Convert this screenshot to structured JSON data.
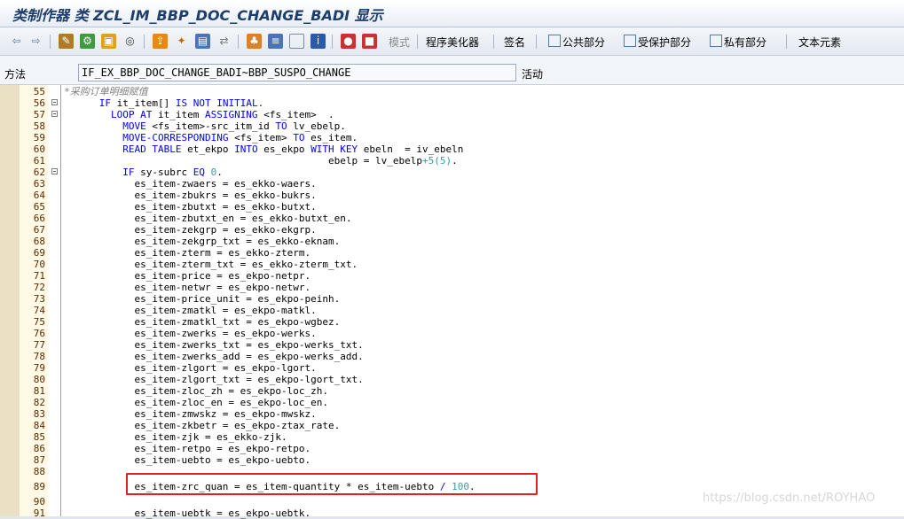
{
  "window": {
    "title": "类制作器 类 ZCL_IM_BBP_DOC_CHANGE_BADI 显示"
  },
  "toolbar": {
    "icons": [
      "back-arrow-icon",
      "forward-arrow-icon",
      "edit-toggle-icon",
      "other-object-icon",
      "activate-icon",
      "check-icon",
      "where-used-icon",
      "display-object-list-icon",
      "navigate-icon",
      "enhance-icon",
      "hierarchy-icon",
      "pretty-print-icon",
      "fullscreen-icon",
      "info-icon",
      "breakpoint-icon",
      "stop-icon"
    ],
    "mode_label": "模式",
    "pretty_printer_label": "程序美化器",
    "signature_label": "签名",
    "public_section_label": "公共部分",
    "protected_section_label": "受保护部分",
    "private_section_label": "私有部分",
    "text_elements_label": "文本元素"
  },
  "method_bar": {
    "label": "方法",
    "value": "IF_EX_BBP_DOC_CHANGE_BADI~BBP_SUSPO_CHANGE",
    "status": "活动"
  },
  "code_lines": [
    {
      "n": "55",
      "fold": false,
      "segs": [
        {
          "t": "*采购订单明细赋值",
          "c": "cm"
        }
      ]
    },
    {
      "n": "56",
      "fold": true,
      "segs": [
        {
          "t": "      "
        },
        {
          "t": "IF",
          "c": "kw"
        },
        {
          "t": " it_item[] "
        },
        {
          "t": "IS NOT INITIAL.",
          "c": "kw"
        }
      ]
    },
    {
      "n": "57",
      "fold": true,
      "segs": [
        {
          "t": "        "
        },
        {
          "t": "LOOP AT",
          "c": "kw"
        },
        {
          "t": " it_item "
        },
        {
          "t": "ASSIGNING",
          "c": "kw"
        },
        {
          "t": " <fs_item>  ."
        }
      ]
    },
    {
      "n": "58",
      "fold": false,
      "segs": [
        {
          "t": "          "
        },
        {
          "t": "MOVE",
          "c": "kw"
        },
        {
          "t": " <fs_item>-src_itm_id "
        },
        {
          "t": "TO",
          "c": "kw"
        },
        {
          "t": " lv_ebelp."
        }
      ]
    },
    {
      "n": "59",
      "fold": false,
      "segs": [
        {
          "t": "          "
        },
        {
          "t": "MOVE-CORRESPONDING",
          "c": "kw"
        },
        {
          "t": " <fs_item> "
        },
        {
          "t": "TO",
          "c": "kw"
        },
        {
          "t": " es_item."
        }
      ]
    },
    {
      "n": "60",
      "fold": false,
      "segs": [
        {
          "t": "          "
        },
        {
          "t": "READ TABLE",
          "c": "kw"
        },
        {
          "t": " et_ekpo "
        },
        {
          "t": "INTO",
          "c": "kw"
        },
        {
          "t": " es_ekpo "
        },
        {
          "t": "WITH KEY",
          "c": "kw"
        },
        {
          "t": " ebeln  = iv_ebeln"
        }
      ]
    },
    {
      "n": "61",
      "fold": false,
      "segs": [
        {
          "t": "                                             ebelp = lv_ebelp"
        },
        {
          "t": "+5(5)",
          "c": "num"
        },
        {
          "t": "."
        }
      ]
    },
    {
      "n": "62",
      "fold": true,
      "segs": [
        {
          "t": "          "
        },
        {
          "t": "IF",
          "c": "kw"
        },
        {
          "t": " sy-subrc "
        },
        {
          "t": "EQ",
          "c": "kw"
        },
        {
          "t": " "
        },
        {
          "t": "0",
          "c": "num"
        },
        {
          "t": "."
        }
      ]
    },
    {
      "n": "63",
      "fold": false,
      "segs": [
        {
          "t": "            es_item-zwaers = es_ekko-waers."
        }
      ]
    },
    {
      "n": "64",
      "fold": false,
      "segs": [
        {
          "t": "            es_item-zbukrs = es_ekko-bukrs."
        }
      ]
    },
    {
      "n": "65",
      "fold": false,
      "segs": [
        {
          "t": "            es_item-zbutxt = es_ekko-butxt."
        }
      ]
    },
    {
      "n": "66",
      "fold": false,
      "segs": [
        {
          "t": "            es_item-zbutxt_en = es_ekko-butxt_en."
        }
      ]
    },
    {
      "n": "67",
      "fold": false,
      "segs": [
        {
          "t": "            es_item-zekgrp = es_ekko-ekgrp."
        }
      ]
    },
    {
      "n": "68",
      "fold": false,
      "segs": [
        {
          "t": "            es_item-zekgrp_txt = es_ekko-eknam."
        }
      ]
    },
    {
      "n": "69",
      "fold": false,
      "segs": [
        {
          "t": "            es_item-zterm = es_ekko-zterm."
        }
      ]
    },
    {
      "n": "70",
      "fold": false,
      "segs": [
        {
          "t": "            es_item-zterm_txt = es_ekko-zterm_txt."
        }
      ]
    },
    {
      "n": "71",
      "fold": false,
      "segs": [
        {
          "t": "            es_item-price = es_ekpo-netpr."
        }
      ]
    },
    {
      "n": "72",
      "fold": false,
      "segs": [
        {
          "t": "            es_item-netwr = es_ekpo-netwr."
        }
      ]
    },
    {
      "n": "73",
      "fold": false,
      "segs": [
        {
          "t": "            es_item-price_unit = es_ekpo-peinh."
        }
      ]
    },
    {
      "n": "74",
      "fold": false,
      "segs": [
        {
          "t": "            es_item-zmatkl = es_ekpo-matkl."
        }
      ]
    },
    {
      "n": "75",
      "fold": false,
      "segs": [
        {
          "t": "            es_item-zmatkl_txt = es_ekpo-wgbez."
        }
      ]
    },
    {
      "n": "76",
      "fold": false,
      "segs": [
        {
          "t": "            es_item-zwerks = es_ekpo-werks."
        }
      ]
    },
    {
      "n": "77",
      "fold": false,
      "segs": [
        {
          "t": "            es_item-zwerks_txt = es_ekpo-werks_txt."
        }
      ]
    },
    {
      "n": "78",
      "fold": false,
      "segs": [
        {
          "t": "            es_item-zwerks_add = es_ekpo-werks_add."
        }
      ]
    },
    {
      "n": "79",
      "fold": false,
      "segs": [
        {
          "t": "            es_item-zlgort = es_ekpo-lgort."
        }
      ]
    },
    {
      "n": "80",
      "fold": false,
      "segs": [
        {
          "t": "            es_item-zlgort_txt = es_ekpo-lgort_txt."
        }
      ]
    },
    {
      "n": "81",
      "fold": false,
      "segs": [
        {
          "t": "            es_item-zloc_zh = es_ekpo-loc_zh."
        }
      ]
    },
    {
      "n": "82",
      "fold": false,
      "segs": [
        {
          "t": "            es_item-zloc_en = es_ekpo-loc_en."
        }
      ]
    },
    {
      "n": "83",
      "fold": false,
      "segs": [
        {
          "t": "            es_item-zmwskz = es_ekpo-mwskz."
        }
      ]
    },
    {
      "n": "84",
      "fold": false,
      "segs": [
        {
          "t": "            es_item-zkbetr = es_ekpo-ztax_rate."
        }
      ]
    },
    {
      "n": "85",
      "fold": false,
      "segs": [
        {
          "t": "            es_item-zjk = es_ekko-zjk."
        }
      ]
    },
    {
      "n": "86",
      "fold": false,
      "segs": [
        {
          "t": "            es_item-retpo = es_ekpo-retpo."
        }
      ]
    },
    {
      "n": "87",
      "fold": false,
      "segs": [
        {
          "t": "            es_item-uebto = es_ekpo-uebto."
        }
      ]
    },
    {
      "n": "88",
      "fold": false,
      "segs": []
    },
    {
      "n": "89",
      "fold": false,
      "segs": [
        {
          "t": "            es_item-zrc_quan = es_item-quantity * es_item-uebto "
        },
        {
          "t": "/",
          "c": "kw"
        },
        {
          "t": " "
        },
        {
          "t": "100",
          "c": "num"
        },
        {
          "t": "."
        }
      ]
    },
    {
      "n": "90",
      "fold": false,
      "segs": []
    },
    {
      "n": "91",
      "fold": false,
      "segs": [
        {
          "t": "            es_item-uebtk = es_ekpo-uebtk."
        }
      ]
    }
  ],
  "watermark": "https://blog.csdn.net/ROYHAO"
}
